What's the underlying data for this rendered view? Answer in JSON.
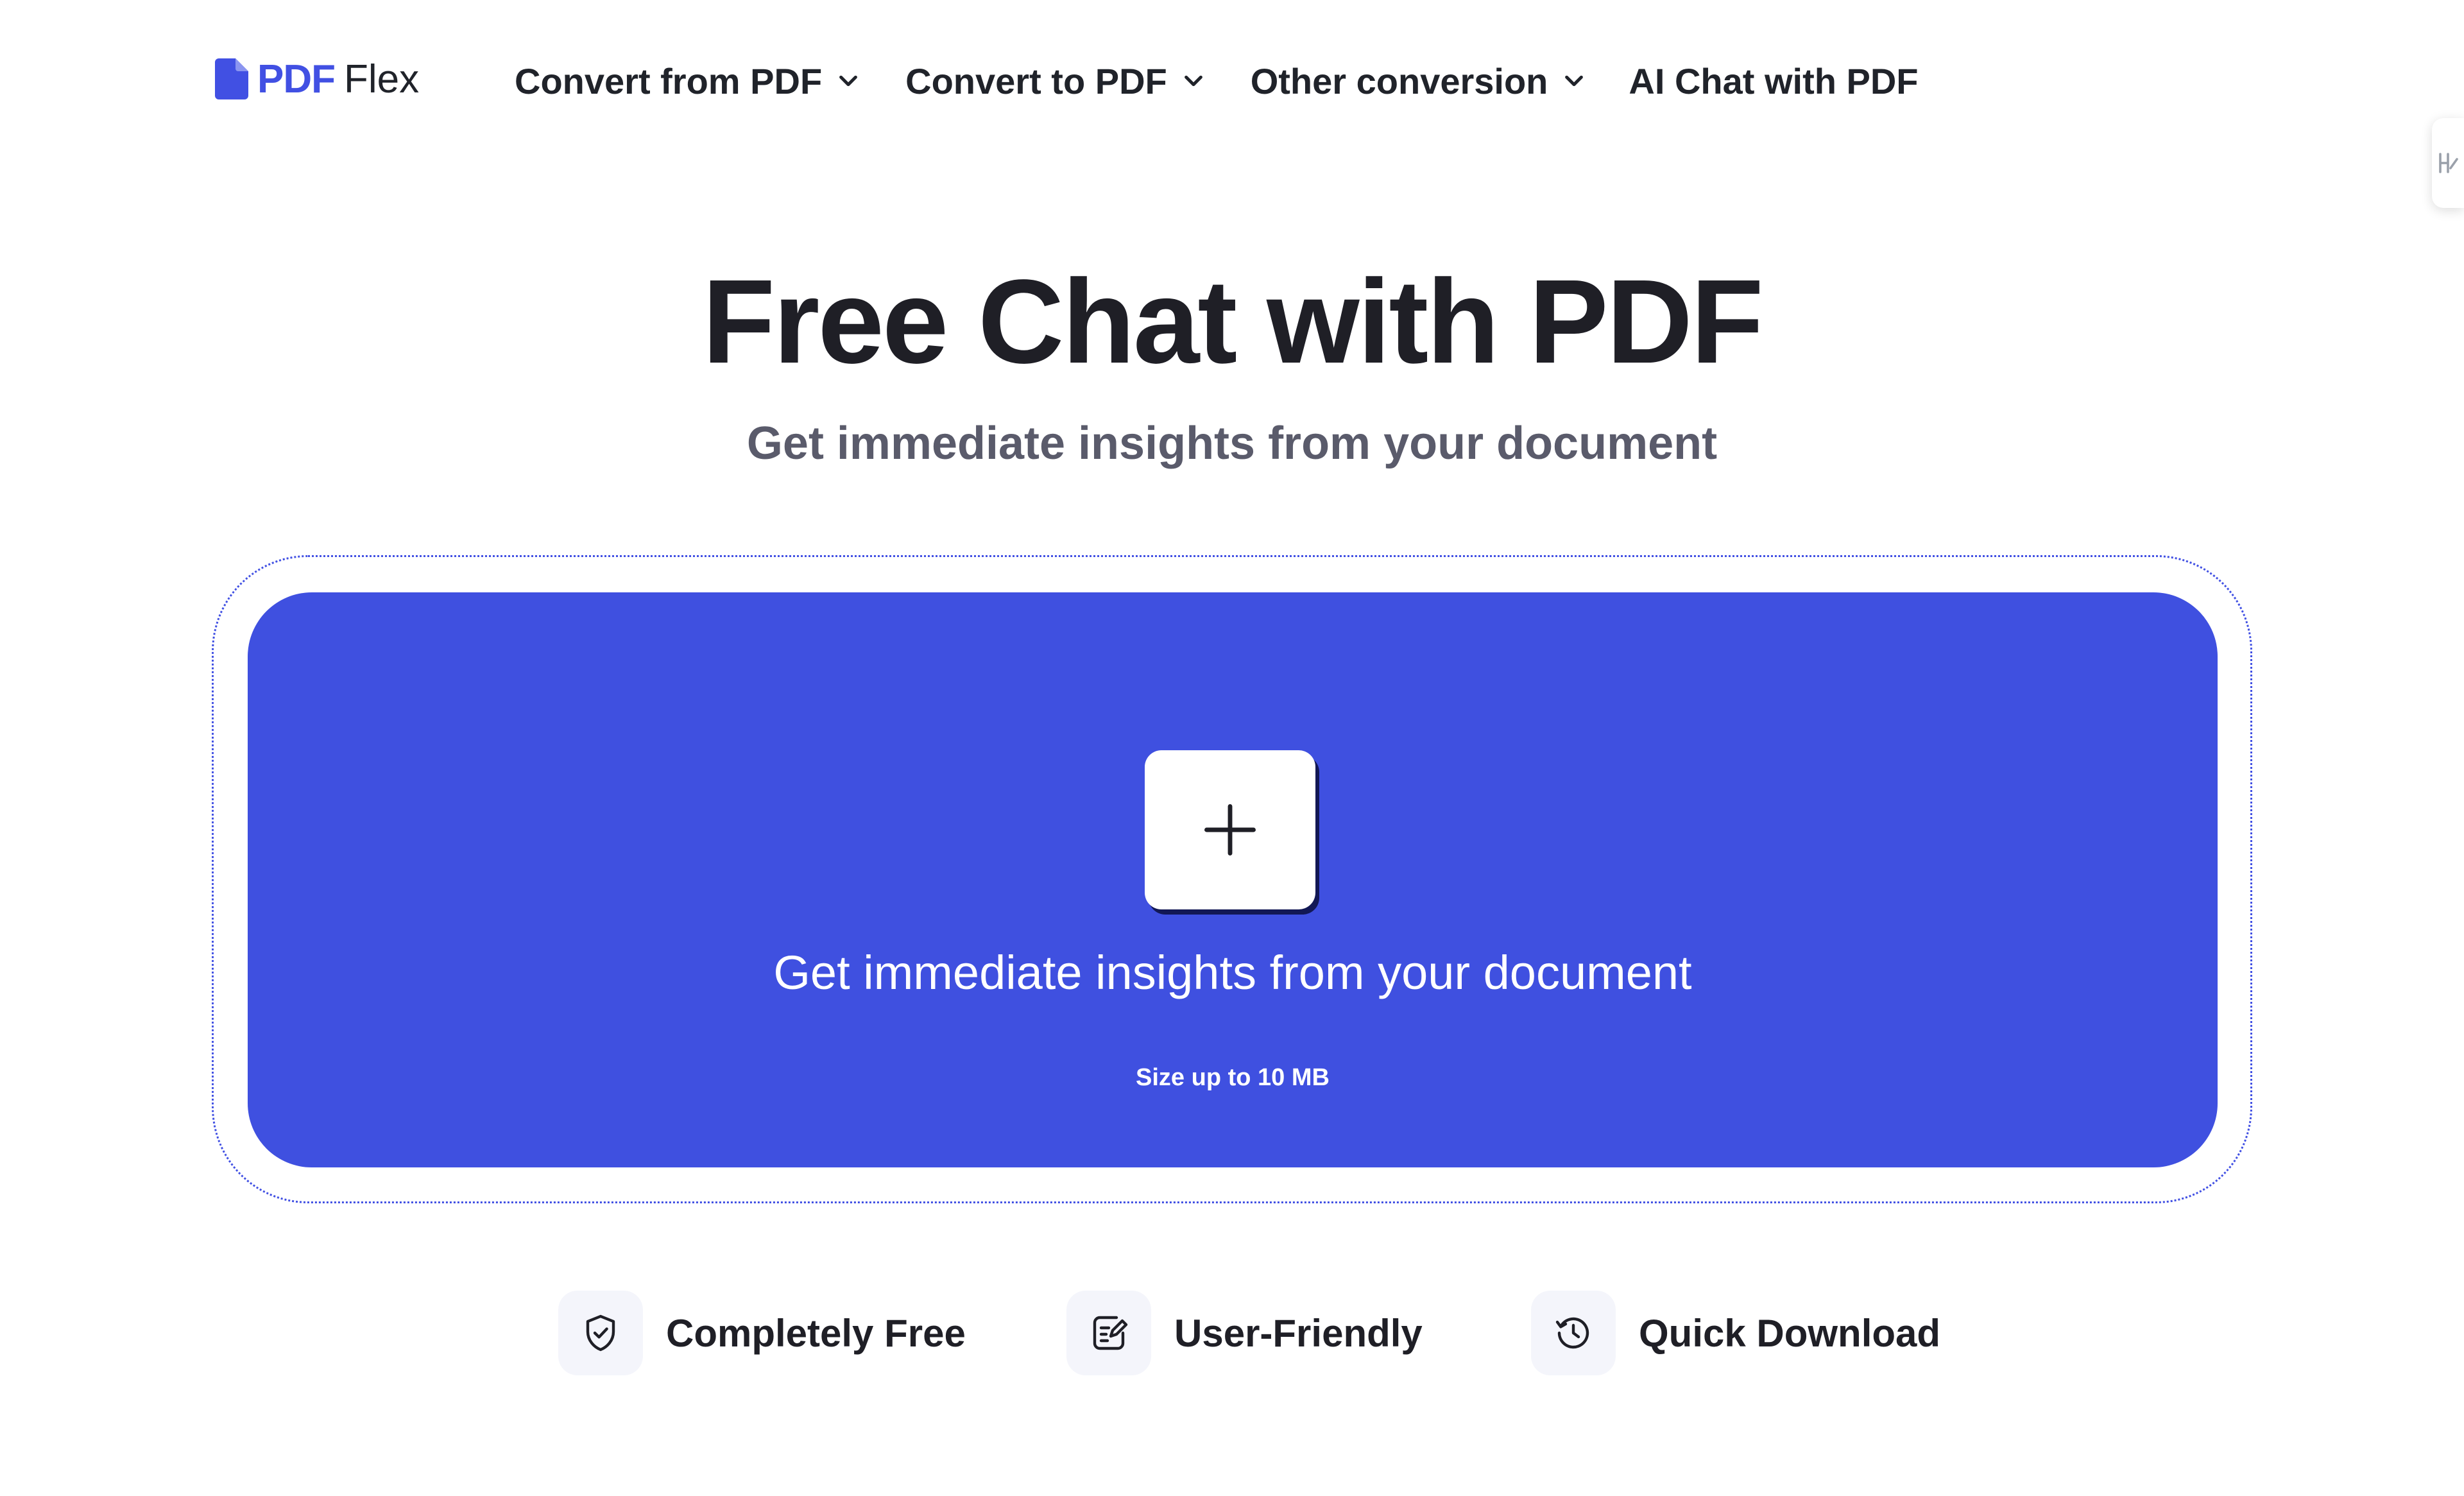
{
  "logo": {
    "brand_primary": "PDF",
    "brand_secondary": "Flex",
    "icon": "document-icon"
  },
  "nav": {
    "items": [
      {
        "label": "Convert from PDF",
        "has_dropdown": true
      },
      {
        "label": "Convert to PDF",
        "has_dropdown": true
      },
      {
        "label": "Other conversion",
        "has_dropdown": true
      },
      {
        "label": "AI Chat with PDF",
        "has_dropdown": false
      }
    ]
  },
  "hero": {
    "title": "Free Chat with PDF",
    "subtitle": "Get immediate insights from your document"
  },
  "upload": {
    "button_icon": "plus-icon",
    "prompt": "Get immediate insights from your document",
    "size_note": "Size up to 10 MB"
  },
  "features": [
    {
      "label": "Completely Free",
      "icon": "shield-check-icon"
    },
    {
      "label": "User-Friendly",
      "icon": "edit-note-icon"
    },
    {
      "label": "Quick Download",
      "icon": "clock-history-icon"
    }
  ],
  "colors": {
    "accent": "#3f50e0",
    "logo_blue": "#4150e3",
    "text_dark": "#1f1f26",
    "text_muted": "#5a5b6b",
    "feature_bg": "#f4f5fb"
  }
}
